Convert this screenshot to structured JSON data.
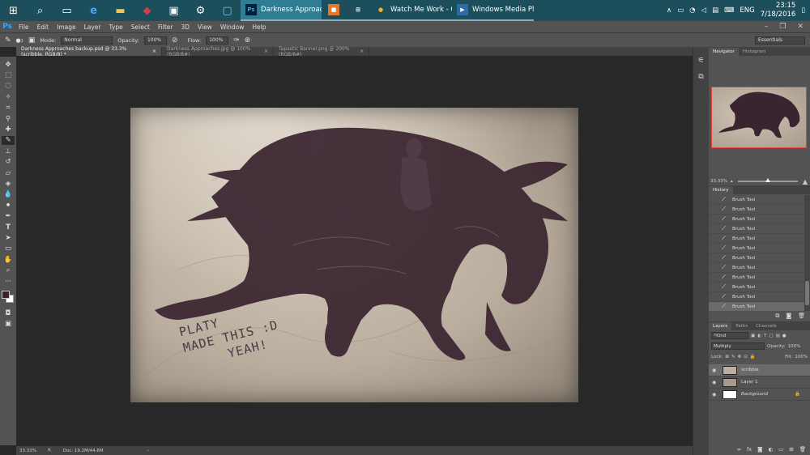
{
  "taskbar": {
    "icons": [
      "windows-icon",
      "search-icon",
      "task-view-icon",
      "edge-icon",
      "file-explorer-icon",
      "app-icon-red",
      "app-icon-dark",
      "app-icon-gear",
      "app-icon-monitor"
    ],
    "apps": [
      {
        "label": "Darkness Approach...",
        "badge": "Ps",
        "active": true
      },
      {
        "label": "",
        "badge": "■",
        "active": false
      },
      {
        "label": "",
        "badge": "⊞",
        "active": false
      },
      {
        "label": "Watch Me Work - G...",
        "badge": "●",
        "active": false
      },
      {
        "label": "Windows Media Pla...",
        "badge": "▶",
        "active": false
      }
    ],
    "tray": {
      "lang": "ENG",
      "time": "23:15",
      "date": "7/18/2016"
    }
  },
  "menubar": {
    "logo": "Ps",
    "items": [
      "File",
      "Edit",
      "Image",
      "Layer",
      "Type",
      "Select",
      "Filter",
      "3D",
      "View",
      "Window",
      "Help"
    ]
  },
  "options": {
    "mode_label": "Mode:",
    "mode_value": "Normal",
    "opacity_label": "Opacity:",
    "opacity_value": "100%",
    "flow_label": "Flow:",
    "flow_value": "100%",
    "brush_size": "1",
    "workspace": "Essentials"
  },
  "doc_tabs": [
    "Darkness Approaches backup.psd @ 33.3% (scribble, RGB/8) *",
    "Darkness Approaches.jpg @ 100% (RGB/8#)",
    "Tapastic Banner.png @ 200% (RGB/8#)"
  ],
  "statusbar": {
    "zoom": "33.33%",
    "doc": "Doc: 19.2M/44.6M"
  },
  "navigator": {
    "tabs": [
      "Navigator",
      "Histogram"
    ],
    "zoom": "33.33%",
    "zoom_level": 0.5
  },
  "history": {
    "title": "History",
    "items": [
      "Brush Tool",
      "Brush Tool",
      "Brush Tool",
      "Brush Tool",
      "Brush Tool",
      "Brush Tool",
      "Brush Tool",
      "Brush Tool",
      "Brush Tool",
      "Brush Tool",
      "Brush Tool",
      "Brush Tool"
    ],
    "selected_index": 11
  },
  "layers": {
    "tabs": [
      "Layers",
      "Paths",
      "Channels"
    ],
    "filter": "Kind",
    "blend_mode": "Multiply",
    "opacity_label": "Opacity:",
    "opacity": "100%",
    "lock_label": "Lock:",
    "fill_label": "Fill:",
    "fill": "100%",
    "items": [
      {
        "name": "scribble",
        "selected": true
      },
      {
        "name": "Layer 1",
        "selected": false
      },
      {
        "name": "Background",
        "selected": false
      }
    ]
  },
  "artwork": {
    "caption_lines": [
      "PLATY",
      "MADE THIS :D",
      "YEAH!"
    ]
  }
}
